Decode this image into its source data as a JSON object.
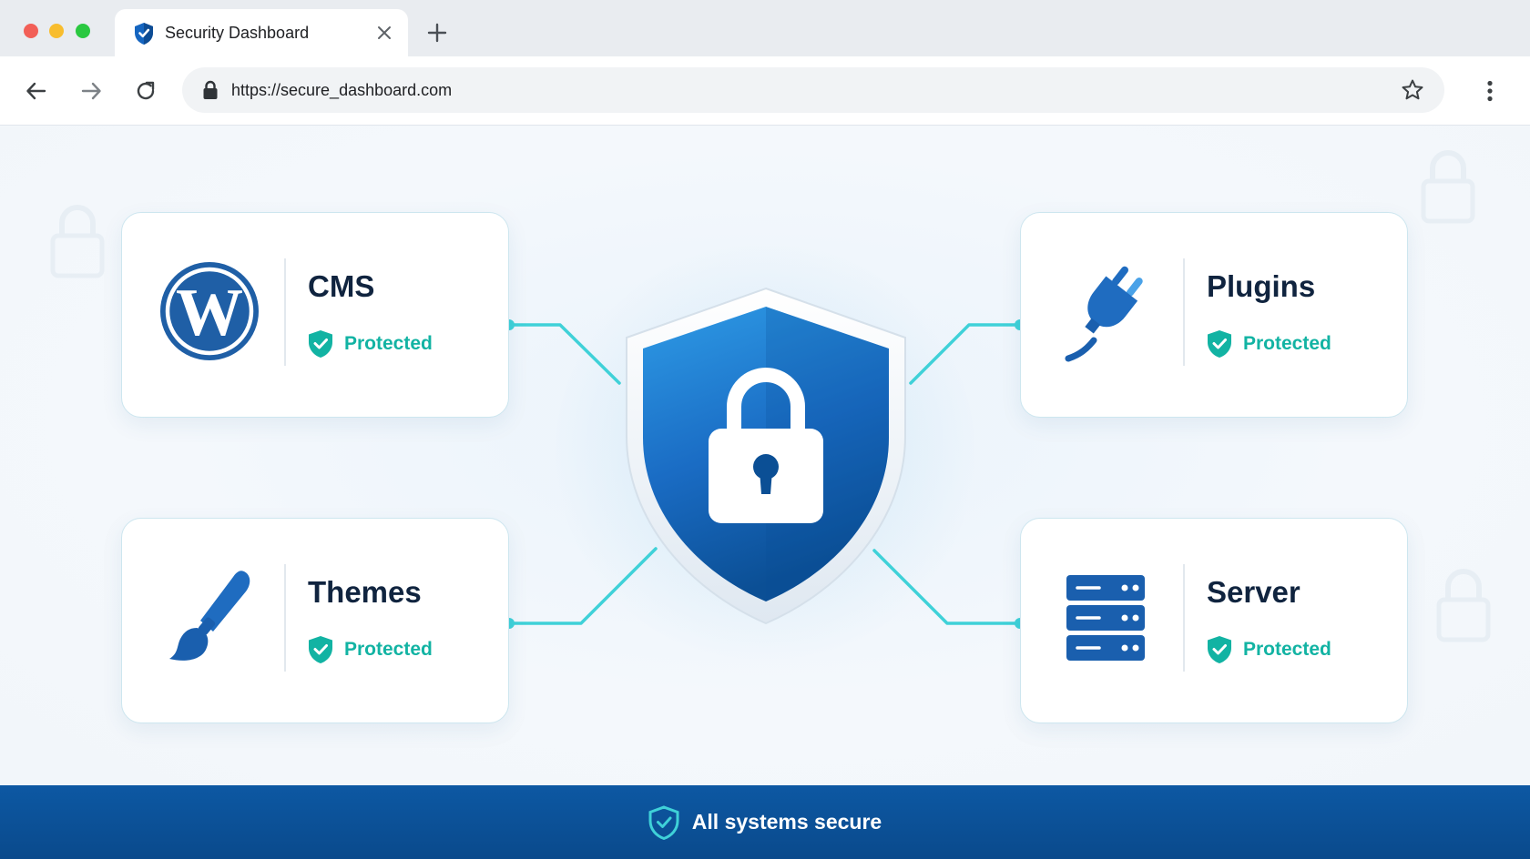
{
  "browser": {
    "tab": {
      "title": "Security Dashboard",
      "favicon": "shield-check-icon",
      "close_icon": "close-icon"
    },
    "new_tab_icon": "plus-icon",
    "toolbar": {
      "back_icon": "arrow-left-icon",
      "forward_icon": "arrow-right-icon",
      "reload_icon": "reload-icon",
      "url": "https://secure_dashboard.com",
      "lock_icon": "lock-icon",
      "bookmark_icon": "star-icon",
      "menu_icon": "more-vertical-icon"
    }
  },
  "dashboard": {
    "center_icon": "shield-lock-icon",
    "cards": [
      {
        "id": "cms",
        "icon": "wordpress-icon",
        "title": "CMS",
        "status": "Protected"
      },
      {
        "id": "plugins",
        "icon": "plug-icon",
        "title": "Plugins",
        "status": "Protected"
      },
      {
        "id": "themes",
        "icon": "paintbrush-icon",
        "title": "Themes",
        "status": "Protected"
      },
      {
        "id": "server",
        "icon": "server-icon",
        "title": "Server",
        "status": "Protected"
      }
    ]
  },
  "footer": {
    "icon": "shield-check-icon",
    "text": "All systems secure"
  },
  "colors": {
    "primary_blue": "#1a6cc4",
    "dark_blue": "#0b4f95",
    "status_teal": "#12b3a3",
    "connector_cyan": "#3fd1d8",
    "title_navy": "#10243f",
    "footer_blue": "#0d58a3"
  }
}
